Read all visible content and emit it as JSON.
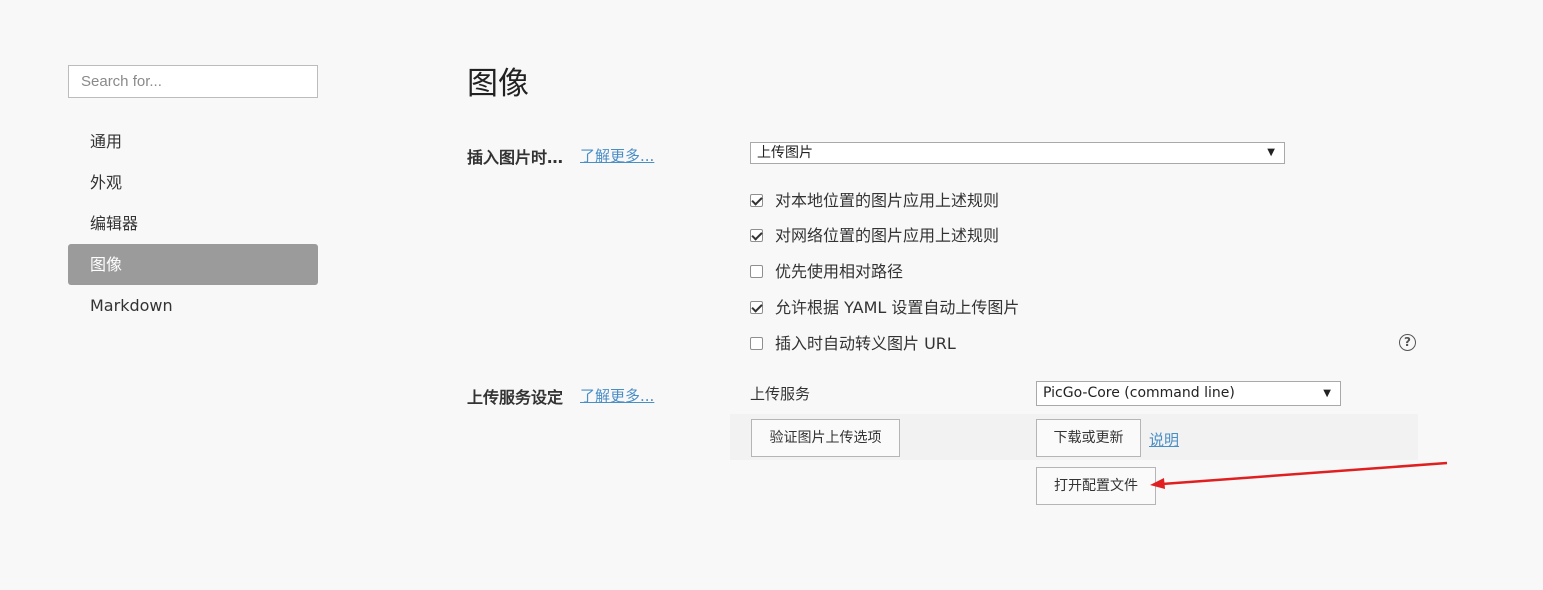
{
  "sidebar": {
    "search_placeholder": "Search for...",
    "items": [
      {
        "label": "通用"
      },
      {
        "label": "外观"
      },
      {
        "label": "编辑器"
      },
      {
        "label": "图像",
        "active": true
      },
      {
        "label": "Markdown"
      }
    ]
  },
  "main": {
    "title": "图像",
    "insert_section": {
      "label": "插入图片时…",
      "learn_more": "了解更多...",
      "select_value": "上传图片",
      "options": [
        {
          "label": "对本地位置的图片应用上述规则",
          "checked": true
        },
        {
          "label": "对网络位置的图片应用上述规则",
          "checked": true
        },
        {
          "label": "优先使用相对路径",
          "checked": false
        },
        {
          "label": "允许根据 YAML 设置自动上传图片",
          "checked": true
        },
        {
          "label": "插入时自动转义图片 URL",
          "checked": false
        }
      ],
      "help_icon": "question-circle-icon"
    },
    "upload_section": {
      "label": "上传服务设定",
      "learn_more": "了解更多...",
      "service_label": "上传服务",
      "service_value": "PicGo-Core (command line)",
      "verify_button": "验证图片上传选项",
      "download_button": "下载或更新",
      "explain_link": "说明",
      "open_config_button": "打开配置文件"
    }
  },
  "annotation": {
    "arrow_color": "#e02020"
  },
  "colors": {
    "accent_link": "#4a8ec6",
    "sidebar_active_bg": "#9b9b9b",
    "background": "#f8f8f8"
  }
}
